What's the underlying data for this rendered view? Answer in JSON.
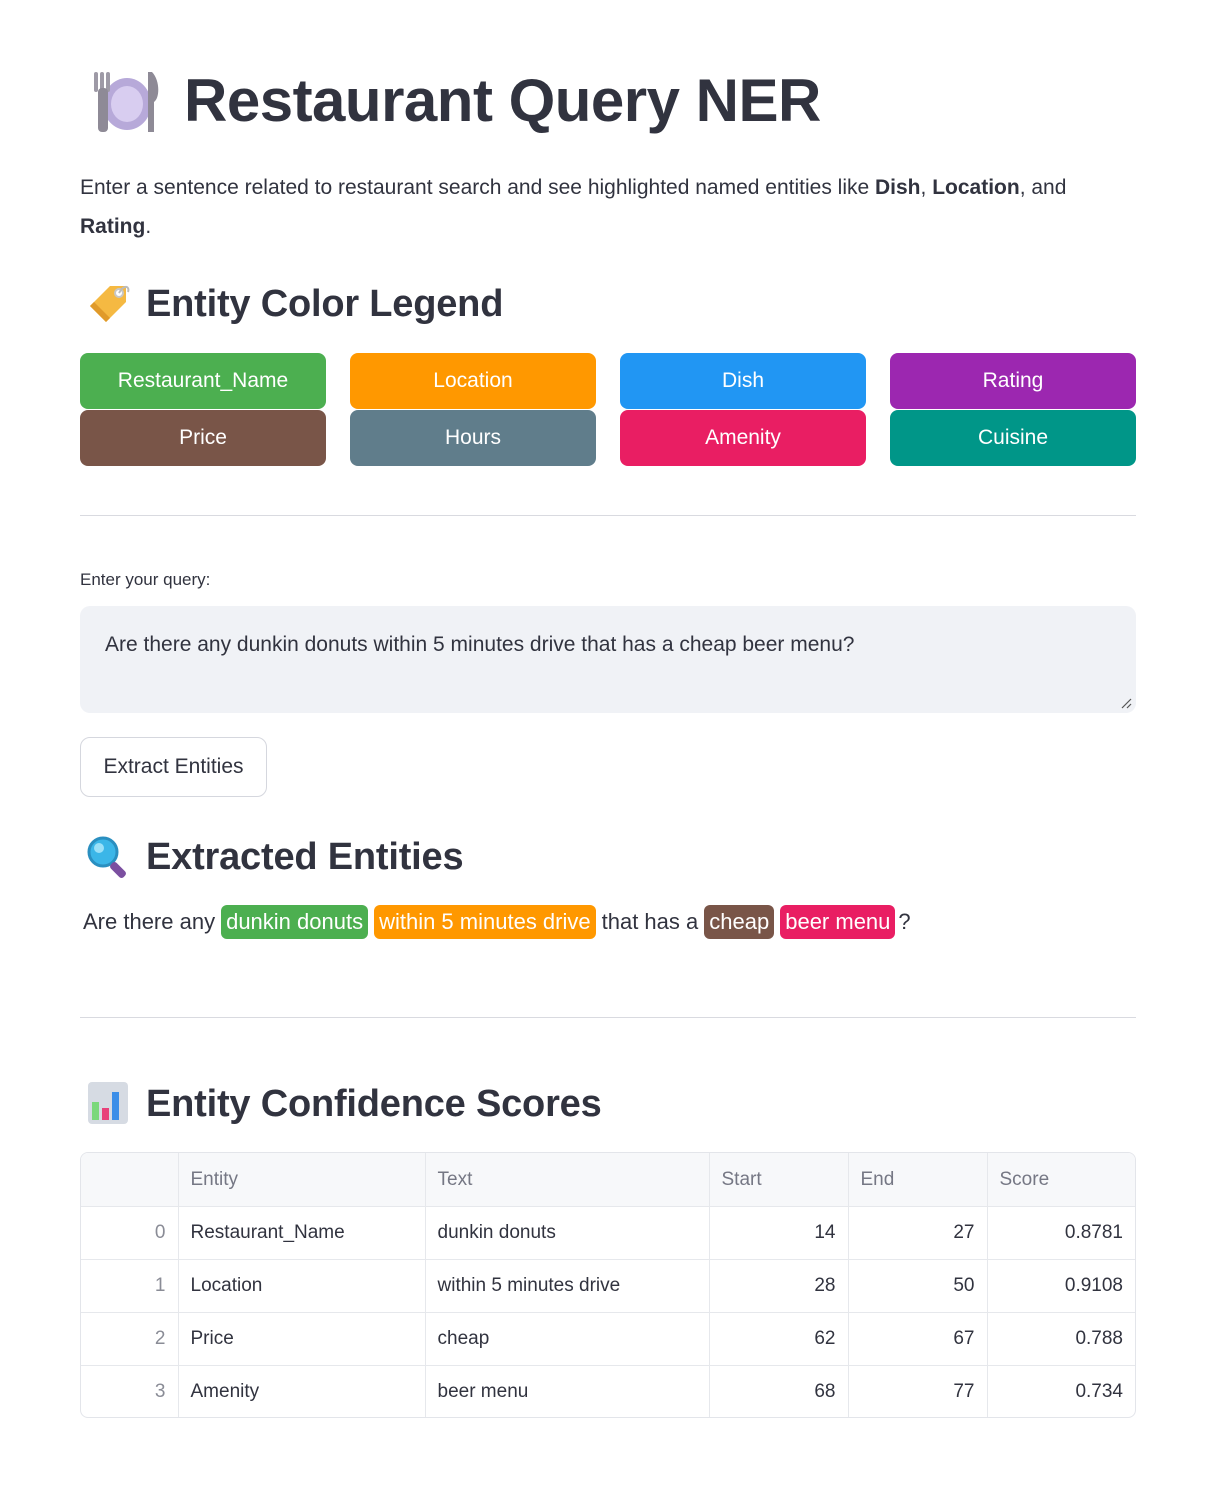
{
  "header": {
    "title": "Restaurant Query NER",
    "icon": "plate-cutlery-icon"
  },
  "intro": {
    "prefix": "Enter a sentence related to restaurant search and see highlighted named entities like ",
    "dish": "Dish",
    "comma1": ", ",
    "location": "Location",
    "and": ", and ",
    "rating": "Rating",
    "suffix": "."
  },
  "legend": {
    "heading": "Entity Color Legend",
    "icon": "label-tag-icon",
    "items": [
      {
        "label": "Restaurant_Name",
        "color": "#4caf50"
      },
      {
        "label": "Location",
        "color": "#ff9800"
      },
      {
        "label": "Dish",
        "color": "#2196f3"
      },
      {
        "label": "Rating",
        "color": "#9c27b0"
      },
      {
        "label": "Price",
        "color": "#795548"
      },
      {
        "label": "Hours",
        "color": "#607d8b"
      },
      {
        "label": "Amenity",
        "color": "#e91e63"
      },
      {
        "label": "Cuisine",
        "color": "#009688"
      }
    ]
  },
  "query": {
    "label": "Enter your query:",
    "value": "Are there any dunkin donuts within 5 minutes drive that has a cheap beer menu?",
    "button": "Extract Entities"
  },
  "extracted": {
    "heading": "Extracted Entities",
    "icon": "magnifying-glass-icon",
    "segments": [
      {
        "text": "Are there any"
      },
      {
        "text": "dunkin donuts",
        "color": "#4caf50"
      },
      {
        "text": "within 5 minutes drive",
        "color": "#ff9800"
      },
      {
        "text": "that has a"
      },
      {
        "text": "cheap",
        "color": "#795548"
      },
      {
        "text": "beer menu",
        "color": "#e91e63"
      },
      {
        "text": "?"
      }
    ]
  },
  "scores": {
    "heading": "Entity Confidence Scores",
    "icon": "bar-chart-icon",
    "columns": [
      "",
      "Entity",
      "Text",
      "Start",
      "End",
      "Score"
    ],
    "rows": [
      [
        "0",
        "Restaurant_Name",
        "dunkin donuts",
        "14",
        "27",
        "0.8781"
      ],
      [
        "1",
        "Location",
        "within 5 minutes drive",
        "28",
        "50",
        "0.9108"
      ],
      [
        "2",
        "Price",
        "cheap",
        "62",
        "67",
        "0.788"
      ],
      [
        "3",
        "Amenity",
        "beer menu",
        "68",
        "77",
        "0.734"
      ]
    ]
  }
}
